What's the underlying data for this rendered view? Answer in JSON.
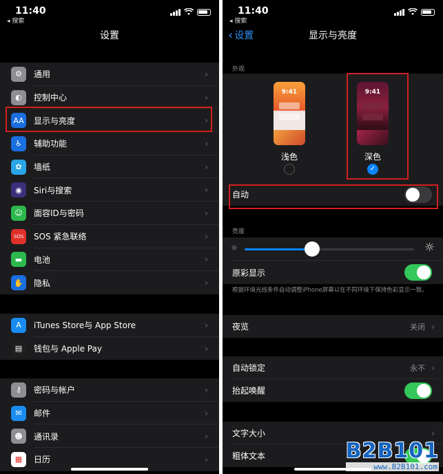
{
  "left": {
    "status": {
      "time": "11:40",
      "back_app": "◂ 搜索"
    },
    "nav_title": "设置",
    "groups": [
      [
        {
          "label": "通用",
          "icon": "gear-icon",
          "color": "#8e8e93",
          "glyph": "⚙"
        },
        {
          "label": "控制中心",
          "icon": "control-center-icon",
          "color": "#8e8e93",
          "glyph": "◐"
        },
        {
          "label": "显示与亮度",
          "icon": "display-icon",
          "color": "#1a6fe0",
          "glyph": "AA"
        },
        {
          "label": "辅助功能",
          "icon": "accessibility-icon",
          "color": "#1a6fe0",
          "glyph": "♿"
        },
        {
          "label": "墙纸",
          "icon": "wallpaper-icon",
          "color": "#2aa5e5",
          "glyph": "✿"
        },
        {
          "label": "Siri与搜索",
          "icon": "siri-icon",
          "color": "#3b2f7a",
          "glyph": "◉"
        },
        {
          "label": "面容ID与密码",
          "icon": "face-id-icon",
          "color": "#2db84d",
          "glyph": "☺"
        },
        {
          "label": "SOS 紧急联络",
          "icon": "sos-icon",
          "color": "#e0302a",
          "glyph": "SOS"
        },
        {
          "label": "电池",
          "icon": "battery-icon",
          "color": "#2db84d",
          "glyph": "▬"
        },
        {
          "label": "隐私",
          "icon": "privacy-hand-icon",
          "color": "#1a6fe0",
          "glyph": "✋"
        }
      ],
      [
        {
          "label": "iTunes Store与 App Store",
          "icon": "app-store-icon",
          "color": "#1a8cf0",
          "glyph": "A"
        },
        {
          "label": "钱包与 Apple Pay",
          "icon": "wallet-icon",
          "color": "#1f1f1f",
          "glyph": "▤"
        }
      ],
      [
        {
          "label": "密码与帐户",
          "icon": "key-icon",
          "color": "#8e8e93",
          "glyph": "⚷"
        },
        {
          "label": "邮件",
          "icon": "mail-icon",
          "color": "#1a8cf0",
          "glyph": "✉"
        },
        {
          "label": "通讯录",
          "icon": "contacts-icon",
          "color": "#8e8e93",
          "glyph": "☻"
        },
        {
          "label": "日历",
          "icon": "calendar-icon",
          "color": "#ffffff",
          "glyph": "▦"
        }
      ]
    ]
  },
  "right": {
    "status": {
      "time": "11:40",
      "back_app": "◂ 搜索"
    },
    "nav_back": "设置",
    "nav_title": "显示与亮度",
    "appearance_section": "外观",
    "light": {
      "time": "9:41",
      "label": "浅色",
      "selected": false
    },
    "dark": {
      "time": "9:41",
      "label": "深色",
      "selected": true
    },
    "auto_label": "自动",
    "auto_on": false,
    "brightness_section": "亮度",
    "brightness_level": 0.4,
    "true_tone_label": "原彩显示",
    "true_tone_on": true,
    "true_tone_desc": "根据环境光线条件自动调整iPhone屏幕以在不同环境下保持色彩显示一致。",
    "night_shift": {
      "label": "夜览",
      "value": "关闭"
    },
    "auto_lock": {
      "label": "自动锁定",
      "value": "永不"
    },
    "raise_to_wake_label": "抬起唤醒",
    "raise_to_wake_on": true,
    "text_size_label": "文字大小",
    "bold_text_label": "粗体文本",
    "bold_text_on": true
  },
  "watermark": {
    "big": "B2B101",
    "small": "www.B2B101.com"
  },
  "accent_colors": {
    "blue": "#0a84ff",
    "green": "#34c759",
    "highlight_red": "#d21f1f"
  }
}
